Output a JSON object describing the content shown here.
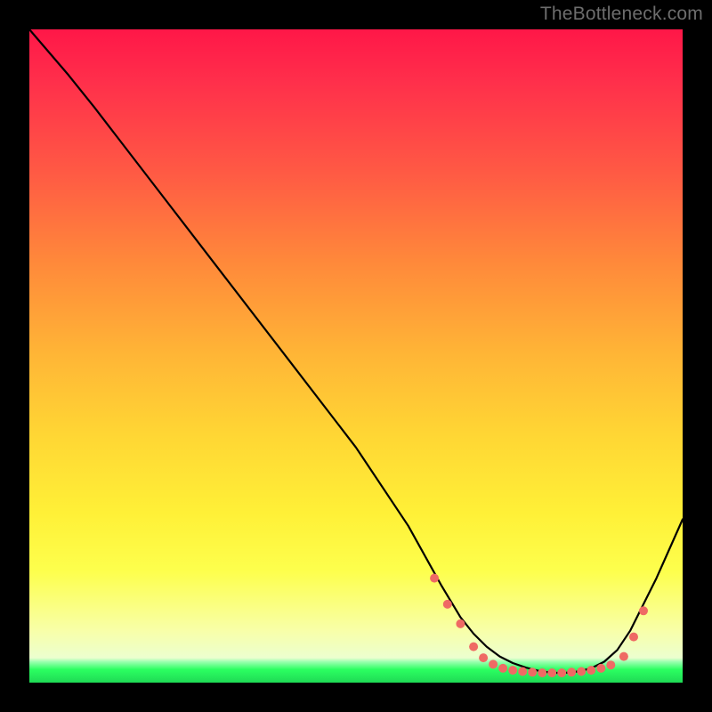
{
  "watermark": "TheBottleneck.com",
  "chart_data": {
    "type": "line",
    "title": "",
    "xlabel": "",
    "ylabel": "",
    "xlim": [
      0,
      100
    ],
    "ylim": [
      0,
      100
    ],
    "grid": false,
    "legend": false,
    "series": [
      {
        "name": "curve",
        "color": "#000000",
        "x": [
          0,
          6,
          10,
          20,
          30,
          40,
          50,
          58,
          63,
          66,
          68,
          70,
          72,
          74,
          76,
          78,
          80,
          82,
          84,
          86,
          88,
          90,
          92,
          96,
          100
        ],
        "y": [
          100,
          93,
          88,
          75,
          62,
          49,
          36,
          24,
          15,
          10,
          7.5,
          5.5,
          4.0,
          3.0,
          2.3,
          1.8,
          1.5,
          1.5,
          1.7,
          2.2,
          3.2,
          5.0,
          8.0,
          16,
          25
        ]
      }
    ],
    "markers": {
      "comment": "dotted salmon markers along the trough",
      "color": "#ef6a64",
      "radius_px": 5,
      "points_xy": [
        [
          62,
          16
        ],
        [
          64,
          12
        ],
        [
          66,
          9
        ],
        [
          68,
          5.5
        ],
        [
          69.5,
          3.8
        ],
        [
          71,
          2.8
        ],
        [
          72.5,
          2.2
        ],
        [
          74,
          1.9
        ],
        [
          75.5,
          1.7
        ],
        [
          77,
          1.6
        ],
        [
          78.5,
          1.5
        ],
        [
          80,
          1.5
        ],
        [
          81.5,
          1.5
        ],
        [
          83,
          1.6
        ],
        [
          84.5,
          1.7
        ],
        [
          86,
          1.9
        ],
        [
          87.5,
          2.2
        ],
        [
          89,
          2.7
        ],
        [
          91,
          4.0
        ],
        [
          92.5,
          7.0
        ],
        [
          94,
          11
        ]
      ]
    },
    "colors": {
      "gradient_top": "#ff1748",
      "gradient_mid": "#ffd634",
      "gradient_low": "#f8ffa8",
      "gradient_bottom": "#1fd955",
      "line": "#000000",
      "marker": "#ef6a64",
      "frame": "#000000"
    }
  }
}
